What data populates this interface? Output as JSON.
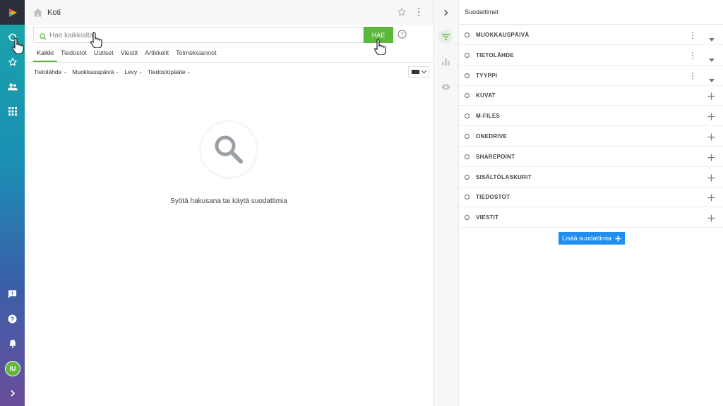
{
  "header": {
    "title": "Koti"
  },
  "search": {
    "placeholder": "Hae kaikkialta",
    "button_label": "HAE"
  },
  "tabs": [
    "Kaikki",
    "Tiedostot",
    "Uutiset",
    "Viestit",
    "Artikkelit",
    "Toimeksiannot"
  ],
  "active_tab": "Kaikki",
  "filters": [
    "Tietolähde",
    "Muokkauspäivä",
    "Levy",
    "Tiedostopääte"
  ],
  "empty_state": {
    "message": "Syötä hakusana tai käytä suodattimia"
  },
  "sidebar": {
    "icons": [
      "logo",
      "search-history-icon",
      "star-icon",
      "people-icon",
      "apps-grid-icon",
      "feedback-icon",
      "help-icon",
      "bell-icon"
    ],
    "avatar_initials": "IU"
  },
  "panel": {
    "title": "Suodattimet",
    "filters": [
      {
        "label": "MUOKKAUSPÄIVÄ",
        "kind": "dropdown"
      },
      {
        "label": "TIETOLÄHDE",
        "kind": "dropdown"
      },
      {
        "label": "TYYPPI",
        "kind": "dropdown"
      },
      {
        "label": "KUVAT",
        "kind": "add"
      },
      {
        "label": "M-FILES",
        "kind": "add"
      },
      {
        "label": "ONEDRIVE",
        "kind": "add"
      },
      {
        "label": "SHAREPOINT",
        "kind": "add"
      },
      {
        "label": "SISÄLTÖLASKURIT",
        "kind": "add"
      },
      {
        "label": "TIEDOSTOT",
        "kind": "add"
      },
      {
        "label": "VIESTIT",
        "kind": "add"
      }
    ],
    "add_filter_label": "Lisää suodattimia"
  },
  "colors": {
    "accent_green": "#5bb83a",
    "accent_blue": "#1f8ef0"
  }
}
